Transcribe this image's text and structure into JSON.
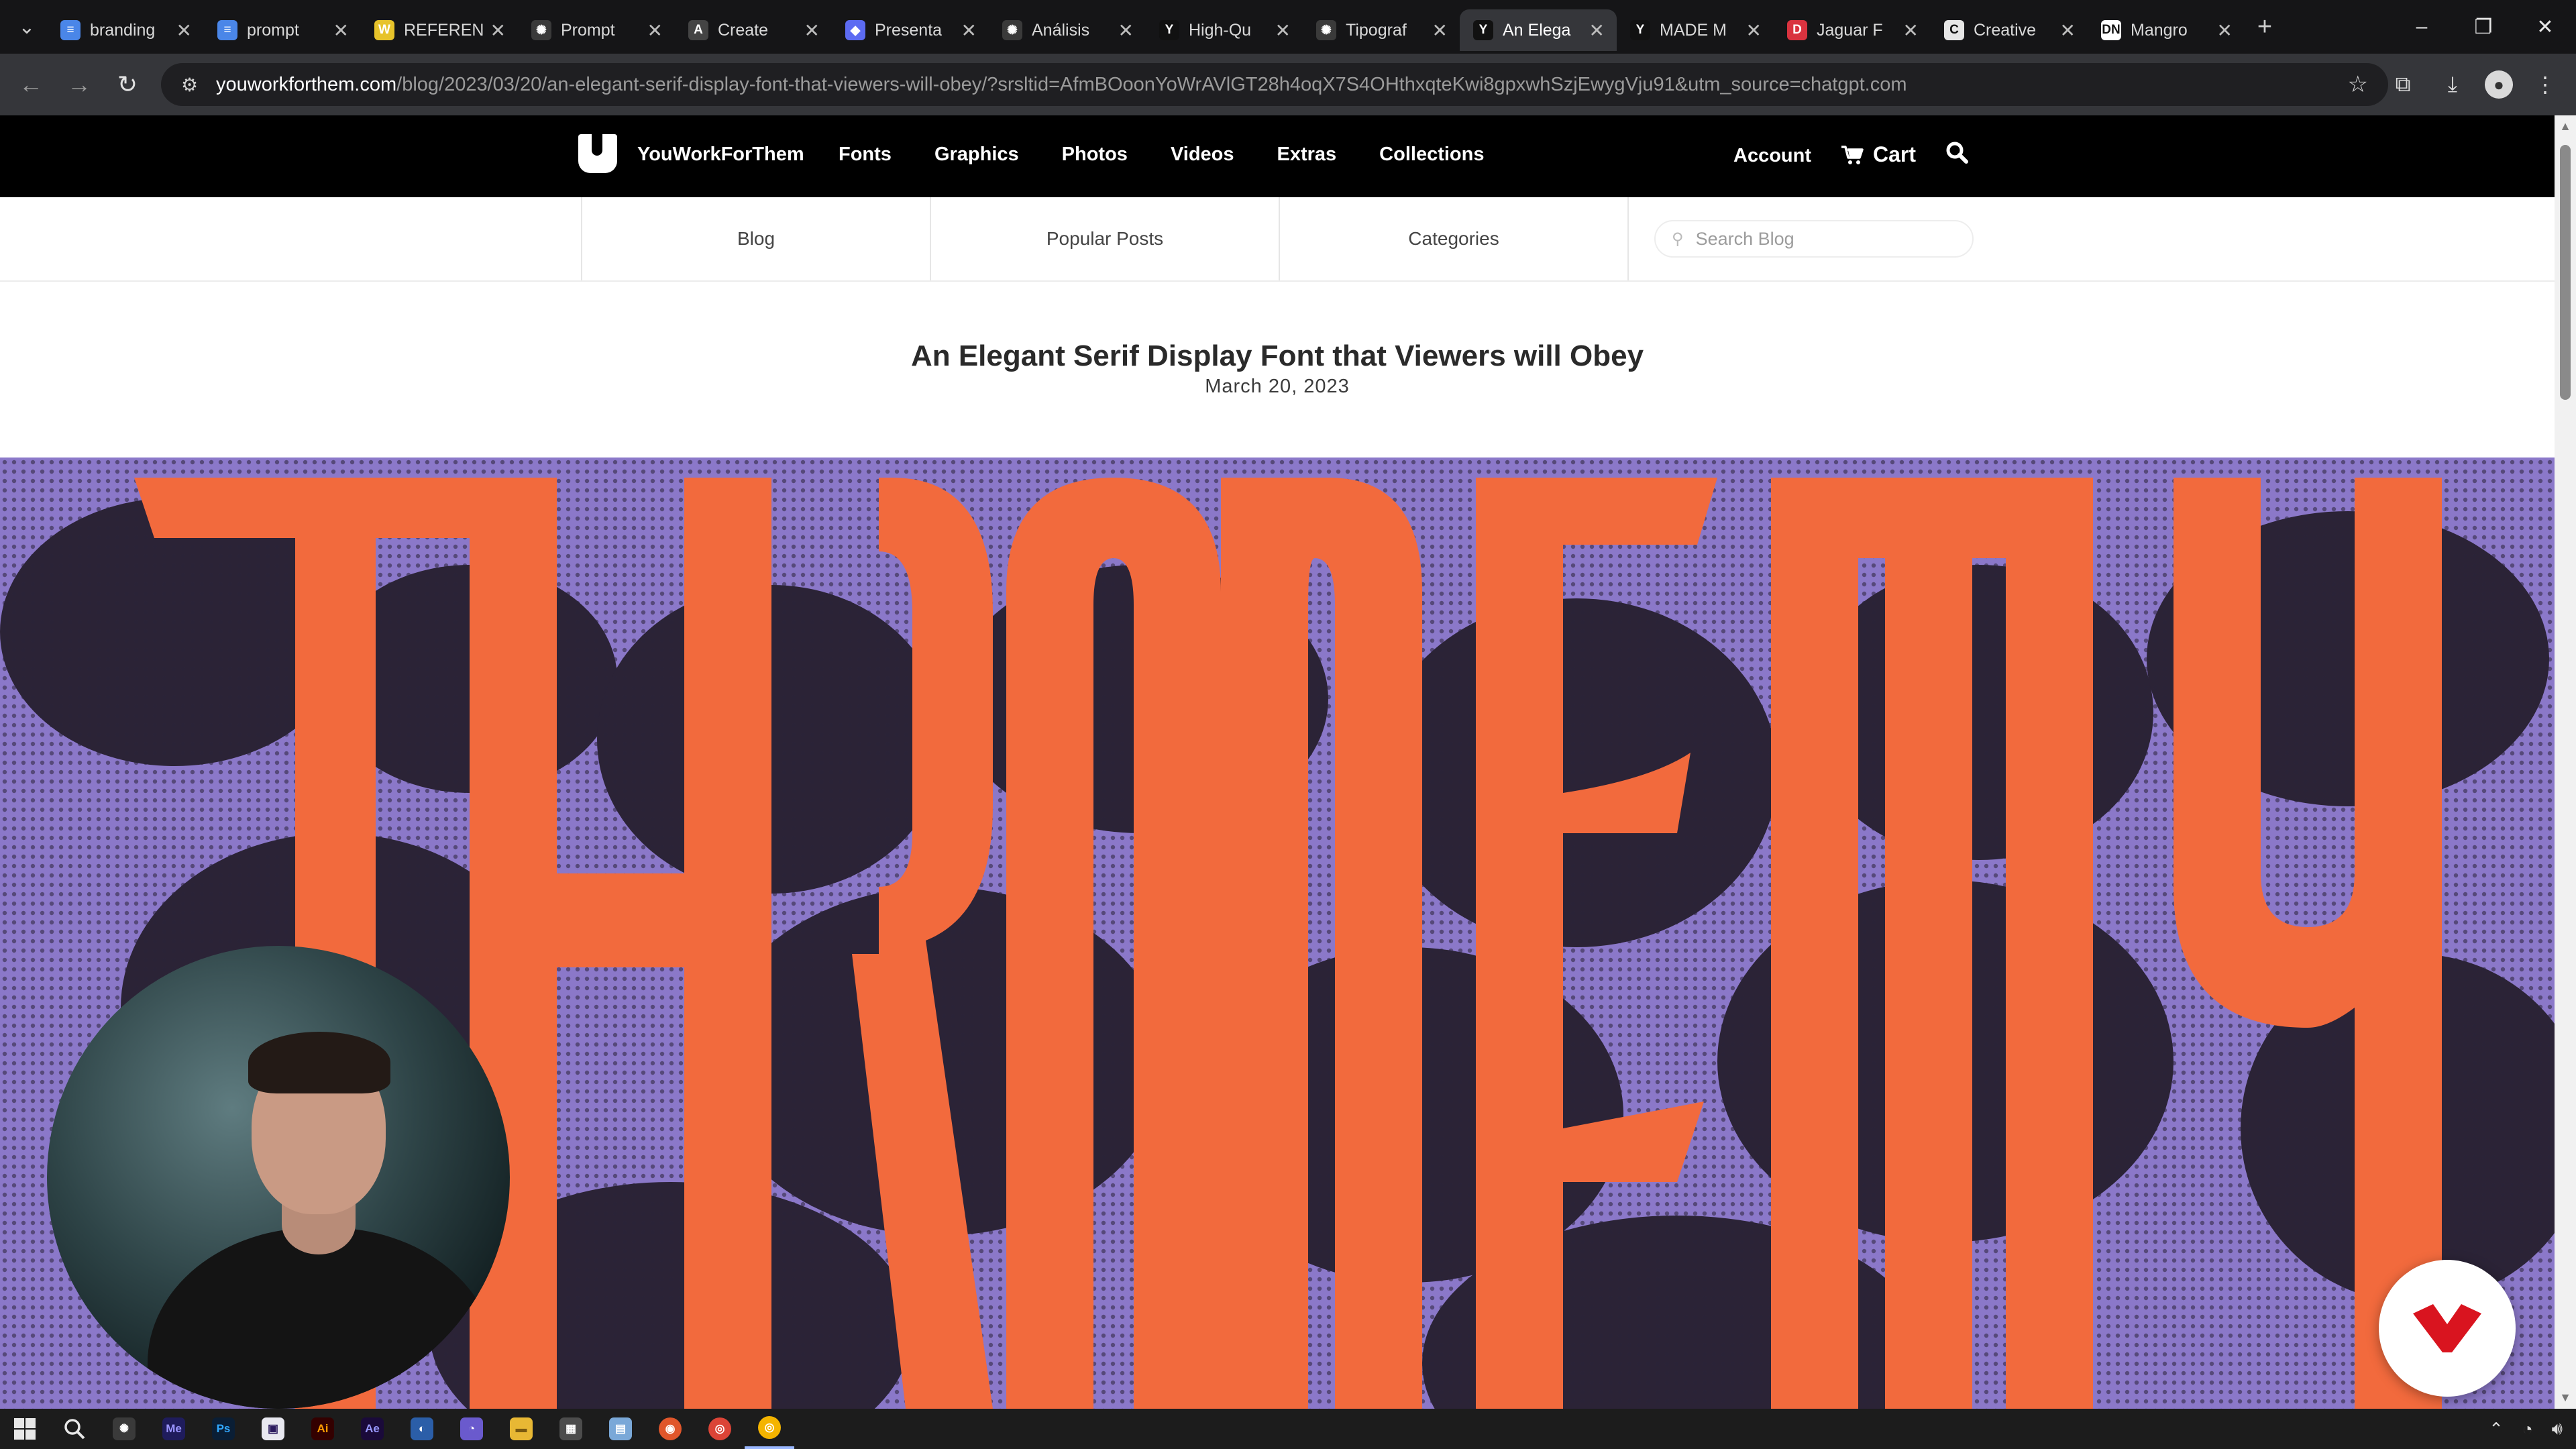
{
  "browser": {
    "tabs": [
      {
        "label": "branding",
        "fav": "docs-icon",
        "favColor": "#4a86e8",
        "favText": "≡"
      },
      {
        "label": "prompt",
        "fav": "docs-icon",
        "favColor": "#4a86e8",
        "favText": "≡"
      },
      {
        "label": "REFEREN",
        "fav": "w-logo-icon",
        "favColor": "#e7c32a",
        "favText": "W"
      },
      {
        "label": "Prompt",
        "fav": "openai-icon",
        "favColor": "#3a3a3a",
        "favText": "✺"
      },
      {
        "label": "Create",
        "fav": "a-logo-icon",
        "favColor": "#444444",
        "favText": "A"
      },
      {
        "label": "Presenta",
        "fav": "shield-icon",
        "favColor": "#5c6bf2",
        "favText": "◆"
      },
      {
        "label": "Análisis",
        "fav": "openai-icon",
        "favColor": "#3a3a3a",
        "favText": "✺"
      },
      {
        "label": "High-Qu",
        "fav": "ywft-icon",
        "favColor": "#111111",
        "favText": "Y"
      },
      {
        "label": "Tipograf",
        "fav": "openai-icon",
        "favColor": "#3a3a3a",
        "favText": "✺"
      },
      {
        "label": "An Elega",
        "fav": "ywft-icon",
        "favColor": "#111111",
        "favText": "Y"
      },
      {
        "label": "MADE M",
        "fav": "ywft-icon",
        "favColor": "#111111",
        "favText": "Y"
      },
      {
        "label": "Jaguar F",
        "fav": "d-logo-icon",
        "favColor": "#d9333f",
        "favText": "D"
      },
      {
        "label": "Creative",
        "fav": "c-logo-icon",
        "favColor": "#e6e6e6",
        "favText": "C"
      },
      {
        "label": "Mangro",
        "fav": "dn-logo-icon",
        "favColor": "#ffffff",
        "favText": "DN"
      }
    ],
    "activeTab": 9,
    "url_host": "youworkforthem.com",
    "url_path": "/blog/2023/03/20/an-elegant-serif-display-font-that-viewers-will-obey/?srsltid=AfmBOoonYoWrAVlGT28h4oqX7S4OHthxqteKwi8gpxwhSzjEwygVju91&utm_source=chatgpt.com"
  },
  "site": {
    "brand": "YouWorkForThem",
    "nav": [
      "Fonts",
      "Graphics",
      "Photos",
      "Videos",
      "Extras",
      "Collections"
    ],
    "account": "Account",
    "cart": "Cart"
  },
  "subnav": {
    "items": [
      "Blog",
      "Popular Posts",
      "Categories"
    ],
    "search_placeholder": "Search Blog"
  },
  "post": {
    "title": "An Elegant Serif Display Font that Viewers will Obey",
    "date": "March 20, 2023"
  },
  "colors": {
    "hero_orange": "#f26a3d",
    "hero_purple": "#8b78c9",
    "widget_red": "#d9141f"
  }
}
